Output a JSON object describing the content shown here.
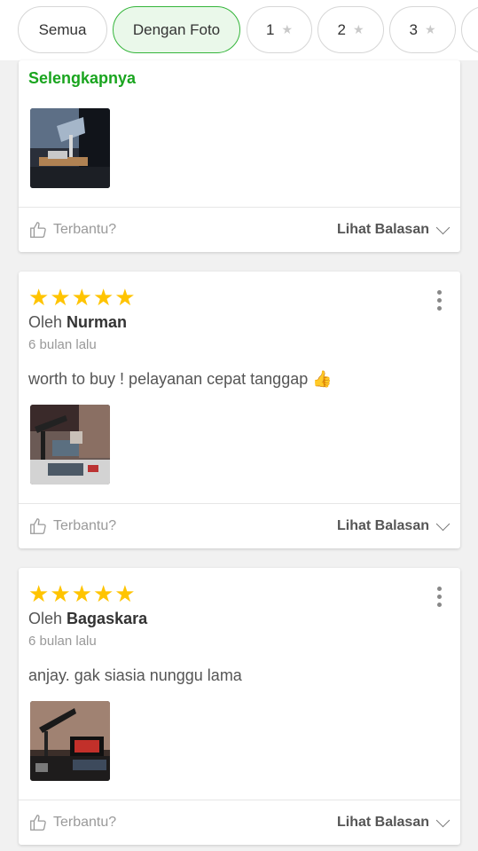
{
  "filters": [
    {
      "label": "Semua",
      "star": false,
      "active": false
    },
    {
      "label": "Dengan Foto",
      "star": false,
      "active": true
    },
    {
      "label": "1",
      "star": true,
      "active": false
    },
    {
      "label": "2",
      "star": true,
      "active": false
    },
    {
      "label": "3",
      "star": true,
      "active": false
    }
  ],
  "common": {
    "helpful_label": "Terbantu?",
    "replies_label": "Lihat Balasan",
    "by_prefix": "Oleh",
    "more_label": "Selengkapnya"
  },
  "reviews": [
    {
      "rating": 5,
      "author": "Nurman",
      "date": "6 bulan lalu",
      "text": "worth to buy ! pelayanan cepat tanggap",
      "emoji": "👍"
    },
    {
      "rating": 5,
      "author": "Bagaskara",
      "date": "6 bulan lalu",
      "text": "anjay. gak siasia nunggu lama",
      "emoji": ""
    }
  ],
  "icons": {
    "star": "star-icon",
    "thumb": "thumbs-up-icon",
    "chevron": "chevron-down-icon",
    "menu": "more-vertical-icon"
  },
  "colors": {
    "accent": "#35b53b",
    "link": "#1aa51f",
    "star": "#ffc400"
  }
}
